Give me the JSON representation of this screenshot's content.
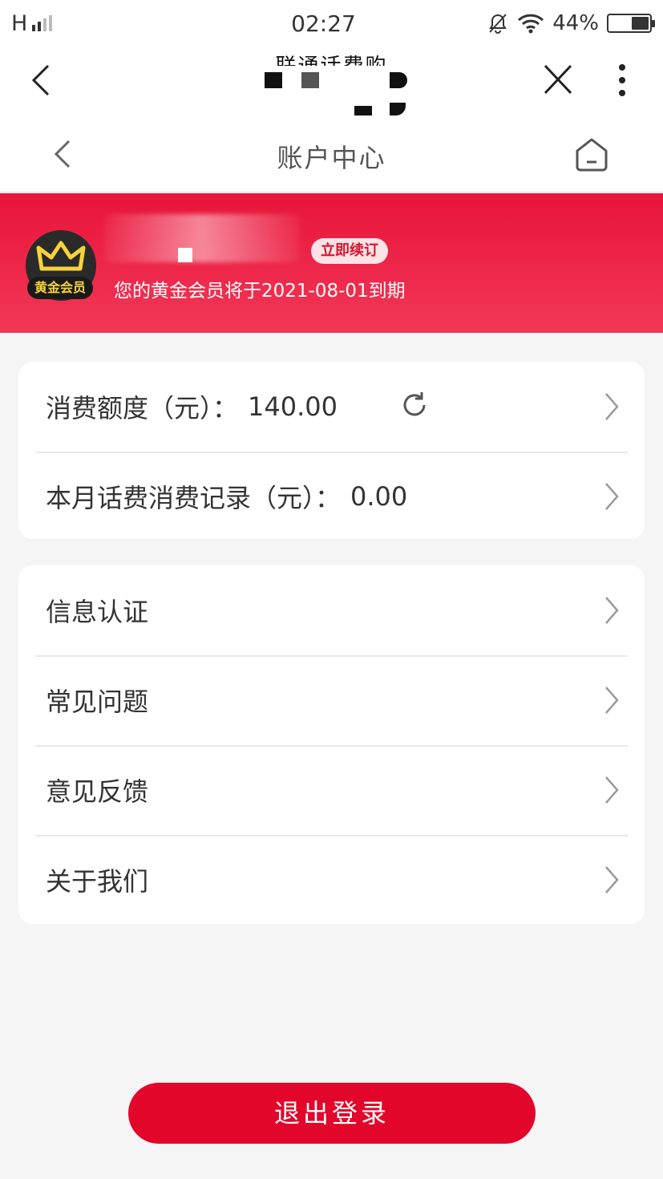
{
  "status_bar": {
    "network": "H",
    "time": "02:27",
    "battery_percent": "44%",
    "battery_level": 0.44
  },
  "webview": {
    "title": "联通话费购"
  },
  "header": {
    "title": "账户中心"
  },
  "member": {
    "badge_label": "黄金会员",
    "renew_label": "立即续订",
    "expiry_text": "您的黄金会员将于2021-08-01到期"
  },
  "balance_card": {
    "rows": [
      {
        "label": "消费额度（元）：",
        "value": "140.00"
      },
      {
        "label": "本月话费消费记录（元）：",
        "value": "0.00"
      }
    ]
  },
  "menu_card": {
    "items": [
      {
        "label": "信息认证"
      },
      {
        "label": "常见问题"
      },
      {
        "label": "意见反馈"
      },
      {
        "label": "关于我们"
      }
    ]
  },
  "logout_label": "退出登录",
  "colors": {
    "brand_red": "#e3062b",
    "banner_red": "#e8143a",
    "badge_gold": "#f7d23a"
  }
}
